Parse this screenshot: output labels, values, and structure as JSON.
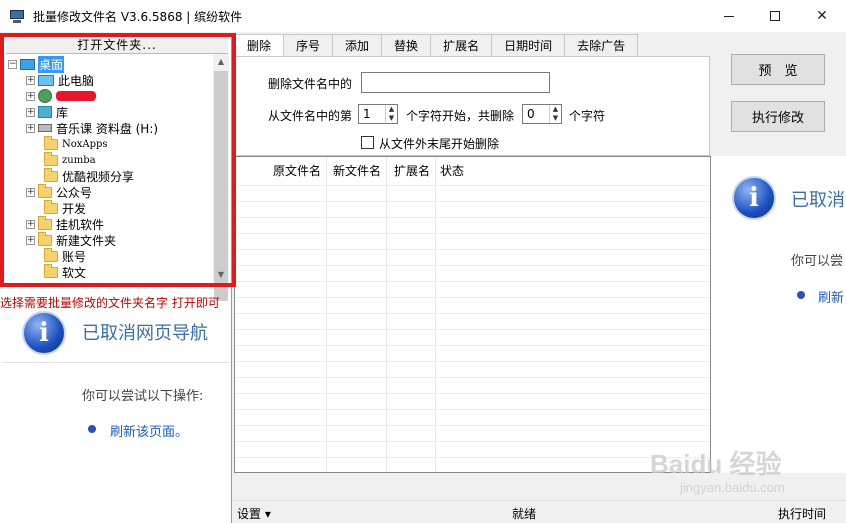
{
  "window": {
    "title": "批量修改文件名 V3.6.5868 | 缤纷软件",
    "minimize": "—",
    "maximize": "□",
    "close": "✕"
  },
  "left": {
    "open_folder_label": "打开文件夹...",
    "tree": [
      {
        "label": "桌面",
        "icon": "desktop-icon",
        "expander": "−",
        "selected": true
      },
      {
        "label": "此电脑",
        "icon": "computer-icon",
        "expander": "+"
      },
      {
        "label": "",
        "icon": "user-icon",
        "expander": "+",
        "redacted": true
      },
      {
        "label": "库",
        "icon": "library-icon",
        "expander": "+"
      },
      {
        "label": "音乐课 资料盘 (H:)",
        "icon": "drive-icon",
        "expander": "+"
      },
      {
        "label": "NoxApps",
        "icon": "folder-icon",
        "expander": ""
      },
      {
        "label": "zumba",
        "icon": "folder-icon",
        "expander": ""
      },
      {
        "label": "优酷视频分享",
        "icon": "folder-icon",
        "expander": ""
      },
      {
        "label": "公众号",
        "icon": "folder-icon",
        "expander": "+"
      },
      {
        "label": "开发",
        "icon": "folder-icon",
        "expander": ""
      },
      {
        "label": "挂机软件",
        "icon": "folder-icon",
        "expander": "+"
      },
      {
        "label": "新建文件夹",
        "icon": "folder-icon",
        "expander": "+"
      },
      {
        "label": "账号",
        "icon": "folder-icon",
        "expander": ""
      },
      {
        "label": "软文",
        "icon": "folder-icon",
        "expander": ""
      }
    ],
    "hint": "选择需要批量修改的文件夹名字 打开即可",
    "nav_cancelled": "已取消网页导航",
    "nav_try": "你可以尝试以下操作:",
    "nav_refresh": "刷新该页面。"
  },
  "tabs": [
    "删除",
    "序号",
    "添加",
    "替换",
    "扩展名",
    "日期时间",
    "去除广告"
  ],
  "delete_tab": {
    "name_contains_label": "删除文件名中的",
    "name_contains_value": "",
    "from_label": "从文件名中的第",
    "start_value": "1",
    "start_suffix": "个字符开始，共删除",
    "count_value": "0",
    "count_suffix": "个字符",
    "from_end_label": "从文件外末尾开始删除"
  },
  "buttons": {
    "preview": "预　览",
    "execute": "执行修改"
  },
  "grid": {
    "columns": [
      "原文件名",
      "新文件名",
      "扩展名",
      "状态"
    ]
  },
  "right": {
    "nav_cancelled": "已取消",
    "nav_try": "你可以尝",
    "nav_refresh": "刷新"
  },
  "statusbar": {
    "settings": "设置 ▾",
    "status": "就绪",
    "exec_time": "执行时间"
  },
  "watermark": {
    "text": "Baidu 经验",
    "sub": "jingyan.baidu.com"
  },
  "colors": {
    "highlight_frame": "#e0191a",
    "hint_text": "#c00000",
    "selection": "#3399ff",
    "link": "#1a5bc2"
  }
}
